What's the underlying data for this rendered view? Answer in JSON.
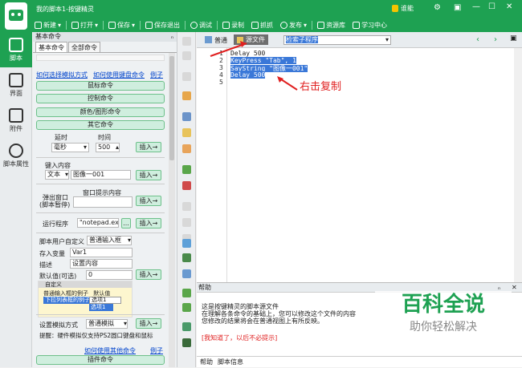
{
  "window": {
    "title": "我的脚本1-按键精灵",
    "vip_label": "谁能"
  },
  "toolbar": {
    "items": [
      "新建",
      "打开",
      "保存",
      "保存退出",
      "调试",
      "录制",
      "抓抓",
      "发布",
      "资源库",
      "学习中心"
    ]
  },
  "left_nav": {
    "items": [
      "脚本",
      "界面",
      "附件",
      "脚本属性"
    ]
  },
  "panel": {
    "title": "基本命令",
    "pin": "ₙ",
    "tabs": [
      "基本命令",
      "全部命令"
    ],
    "links": [
      "如何选择模拟方式",
      "如何使用键盘命令",
      "例子"
    ],
    "groups": [
      "鼠标命令",
      "控制命令",
      "颜色/图形命令",
      "其它命令"
    ],
    "delay": {
      "label1": "延时",
      "label2": "时间",
      "unit": "毫秒",
      "value": "500",
      "insert": "插入→"
    },
    "keyboard": {
      "label": "键入内容",
      "type": "文本",
      "value": "图像一001",
      "insert": "插入→"
    },
    "popup": {
      "label": "弹出窗口",
      "sub": "(脚本暂停)",
      "field_label": "窗口提示内容",
      "insert": "插入→"
    },
    "run": {
      "label": "运行程序",
      "value": "\"notepad.exe\"",
      "browse": "...",
      "insert": "插入→"
    },
    "userdef": {
      "label": "脚本用户自定义",
      "type": "普通输入框",
      "var_label": "存入变量",
      "var_value": "Var1",
      "desc_label": "描述",
      "desc_value": "设置内容",
      "default_label": "默认值(可选)",
      "default_value": "0",
      "insert": "插入→"
    },
    "preview": {
      "header": "自定义",
      "row1_label": "普通输入框的例子",
      "row1_value": "默认值",
      "row2_label": "下拉列表框的例子",
      "row2_value": "选项1",
      "row3_value": "选项1"
    },
    "sim": {
      "label": "设置模拟方式",
      "mode": "普通模拟",
      "insert": "插入→",
      "note": "提醒：硬件模拟仅支持PS2圆口键盘和鼠标"
    },
    "links2": [
      "如何使用其他命令",
      "例子"
    ],
    "plugin": "插件命令"
  },
  "editor": {
    "tab_normal": "普通",
    "tab_source": "源文件",
    "dropdown_label": "检索子程序",
    "lines": [
      "Delay 500",
      "KeyPress \"Tab\", 1",
      "SayString \"图像一001\"",
      "Delay 500"
    ],
    "line_numbers": [
      "1",
      "2",
      "3",
      "4",
      "5"
    ],
    "annotation": "右击复制"
  },
  "help": {
    "title": "帮助",
    "lines": [
      "这是按键精灵的脚本源文件",
      "在理解各条命令的基础上，您可以修改这个文件的内容",
      "您修改的结果将会在普通视图上有所反映。"
    ],
    "warning": "[我知道了，以后不必提示]",
    "tabs": [
      "帮助",
      "脚本信息"
    ]
  },
  "watermark": {
    "main": "百科全说",
    "sub": "助你轻松解决"
  },
  "colors": {
    "brand": "#1ea152",
    "annotation": "#e02020",
    "selection": "#3a78d8"
  }
}
